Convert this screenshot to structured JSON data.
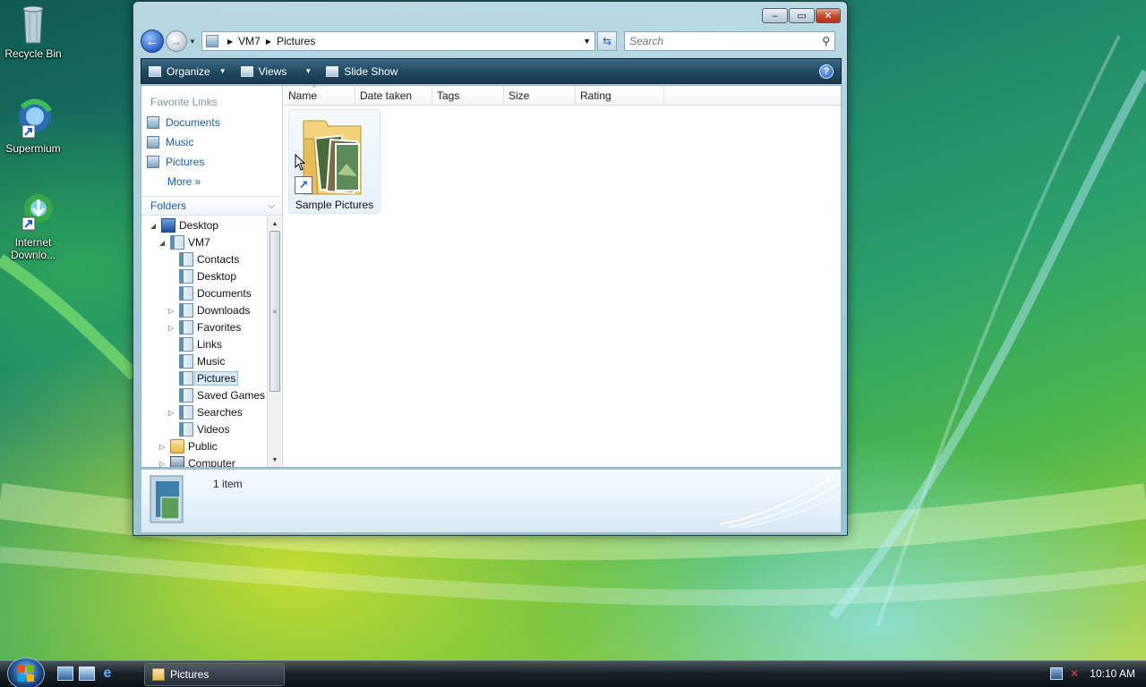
{
  "desktop": {
    "icons": [
      {
        "label": "Recycle Bin"
      },
      {
        "label": "Supermium"
      },
      {
        "label": "Internet Downlo..."
      }
    ]
  },
  "window": {
    "controls": {
      "minimize": "–",
      "maximize": "▭",
      "close": "✕"
    },
    "address": {
      "root": "VM7",
      "current": "Pictures"
    },
    "search_placeholder": "Search",
    "toolbar": {
      "organize": "Organize",
      "views": "Views",
      "slideshow": "Slide Show",
      "help": "?"
    },
    "nav": {
      "favorite_links_title": "Favorite Links",
      "favorites": [
        "Documents",
        "Music",
        "Pictures"
      ],
      "more": "More  »",
      "folders_title": "Folders",
      "tree": [
        {
          "label": "Desktop",
          "indent": 0,
          "twisty": "◢",
          "icon": "desk"
        },
        {
          "label": "VM7",
          "indent": 1,
          "twisty": "◢",
          "icon": "user"
        },
        {
          "label": "Contacts",
          "indent": 2,
          "twisty": "",
          "icon": "lib"
        },
        {
          "label": "Desktop",
          "indent": 2,
          "twisty": "",
          "icon": "lib"
        },
        {
          "label": "Documents",
          "indent": 2,
          "twisty": "",
          "icon": "lib"
        },
        {
          "label": "Downloads",
          "indent": 2,
          "twisty": "▷",
          "icon": "lib"
        },
        {
          "label": "Favorites",
          "indent": 2,
          "twisty": "▷",
          "icon": "lib"
        },
        {
          "label": "Links",
          "indent": 2,
          "twisty": "",
          "icon": "lib"
        },
        {
          "label": "Music",
          "indent": 2,
          "twisty": "",
          "icon": "lib"
        },
        {
          "label": "Pictures",
          "indent": 2,
          "twisty": "",
          "icon": "lib",
          "selected": true
        },
        {
          "label": "Saved Games",
          "indent": 2,
          "twisty": "",
          "icon": "lib"
        },
        {
          "label": "Searches",
          "indent": 2,
          "twisty": "▷",
          "icon": "lib"
        },
        {
          "label": "Videos",
          "indent": 2,
          "twisty": "",
          "icon": "lib"
        },
        {
          "label": "Public",
          "indent": 1,
          "twisty": "▷",
          "icon": "folder"
        },
        {
          "label": "Computer",
          "indent": 1,
          "twisty": "▷",
          "icon": "comp"
        }
      ]
    },
    "columns": [
      "Name",
      "Date taken",
      "Tags",
      "Size",
      "Rating"
    ],
    "items": [
      {
        "label": "Sample Pictures"
      }
    ],
    "details": {
      "count": "1 item"
    }
  },
  "taskbar": {
    "task_label": "Pictures",
    "clock": "10:10 AM"
  }
}
